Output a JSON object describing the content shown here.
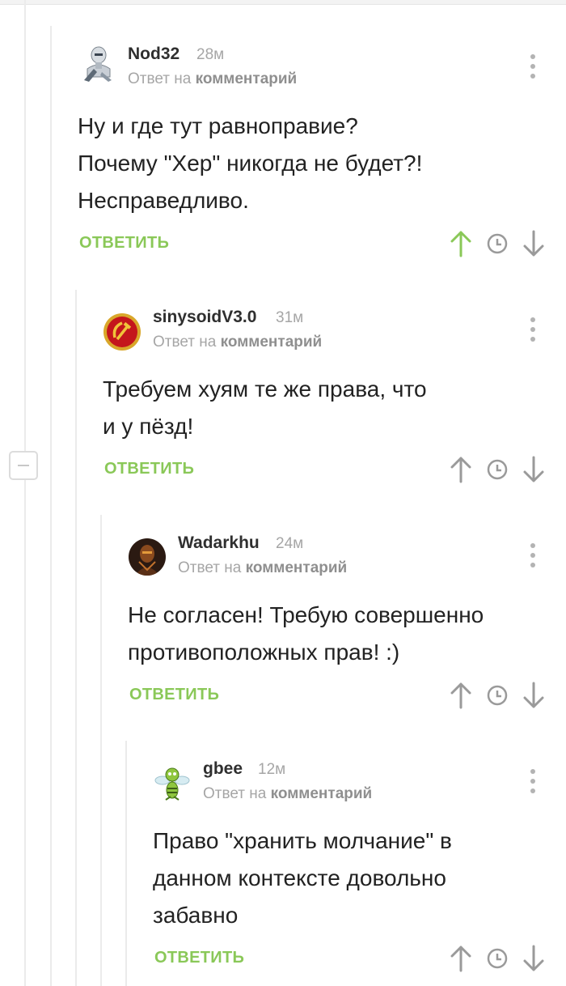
{
  "colors": {
    "accent_green": "#8ac858",
    "icon_gray": "#9a9a9a",
    "meta_gray": "#a6a6a6"
  },
  "comments": [
    {
      "username": "Nod32",
      "time": "28м",
      "reply_prefix": "Ответ на",
      "reply_target": "комментарий",
      "text": "Ну и где тут равноправие?\nПочему \"Хер\" никогда не будет?!\nНесправедливо.",
      "reply_label": "ОТВЕТИТЬ",
      "upvoted": true,
      "avatar_icon": "robot-avatar-icon"
    },
    {
      "username": "sinysoidV3.0",
      "time": "31м",
      "reply_prefix": "Ответ на",
      "reply_target": "комментарий",
      "text": "Требуем хуям те же права, что\nи у пёзд!",
      "reply_label": "ОТВЕТИТЬ",
      "upvoted": false,
      "avatar_icon": "hammer-sickle-emblem-icon"
    },
    {
      "username": "Wadarkhu",
      "time": "24м",
      "reply_prefix": "Ответ на",
      "reply_target": "комментарий",
      "text": "Не согласен! Требую совершенно\nпротивоположных прав! :)",
      "reply_label": "ОТВЕТИТЬ",
      "upvoted": false,
      "avatar_icon": "dark-warrior-avatar-icon"
    },
    {
      "username": "gbee",
      "time": "12м",
      "reply_prefix": "Ответ на",
      "reply_target": "комментарий",
      "text": "Право \"хранить молчание\" в\nданном контексте довольно\nзабавно",
      "reply_label": "ОТВЕТИТЬ",
      "upvoted": false,
      "avatar_icon": "green-bee-avatar-icon"
    }
  ]
}
